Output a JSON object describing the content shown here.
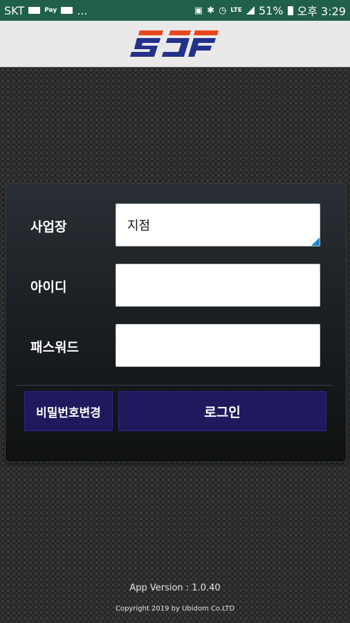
{
  "status_bar": {
    "carrier": "SKT",
    "pay": "Pay",
    "dots": "...",
    "battery_percent": "51%",
    "time": "오후 3:29"
  },
  "header": {
    "logo_text": "SJF"
  },
  "form": {
    "site_label": "사업장",
    "site_value": "지점",
    "id_label": "아이디",
    "id_value": "",
    "password_label": "패스워드",
    "password_value": ""
  },
  "buttons": {
    "change_password": "비밀번호변경",
    "login": "로그인"
  },
  "footer": {
    "version": "App Version : 1.0.40",
    "copyright": "Copyright 2019 by Ubidom Co.LTD"
  },
  "colors": {
    "status_bar": "#205f4c",
    "button": "#1f1a5e",
    "logo_orange": "#e8471d",
    "logo_blue": "#23318a"
  }
}
